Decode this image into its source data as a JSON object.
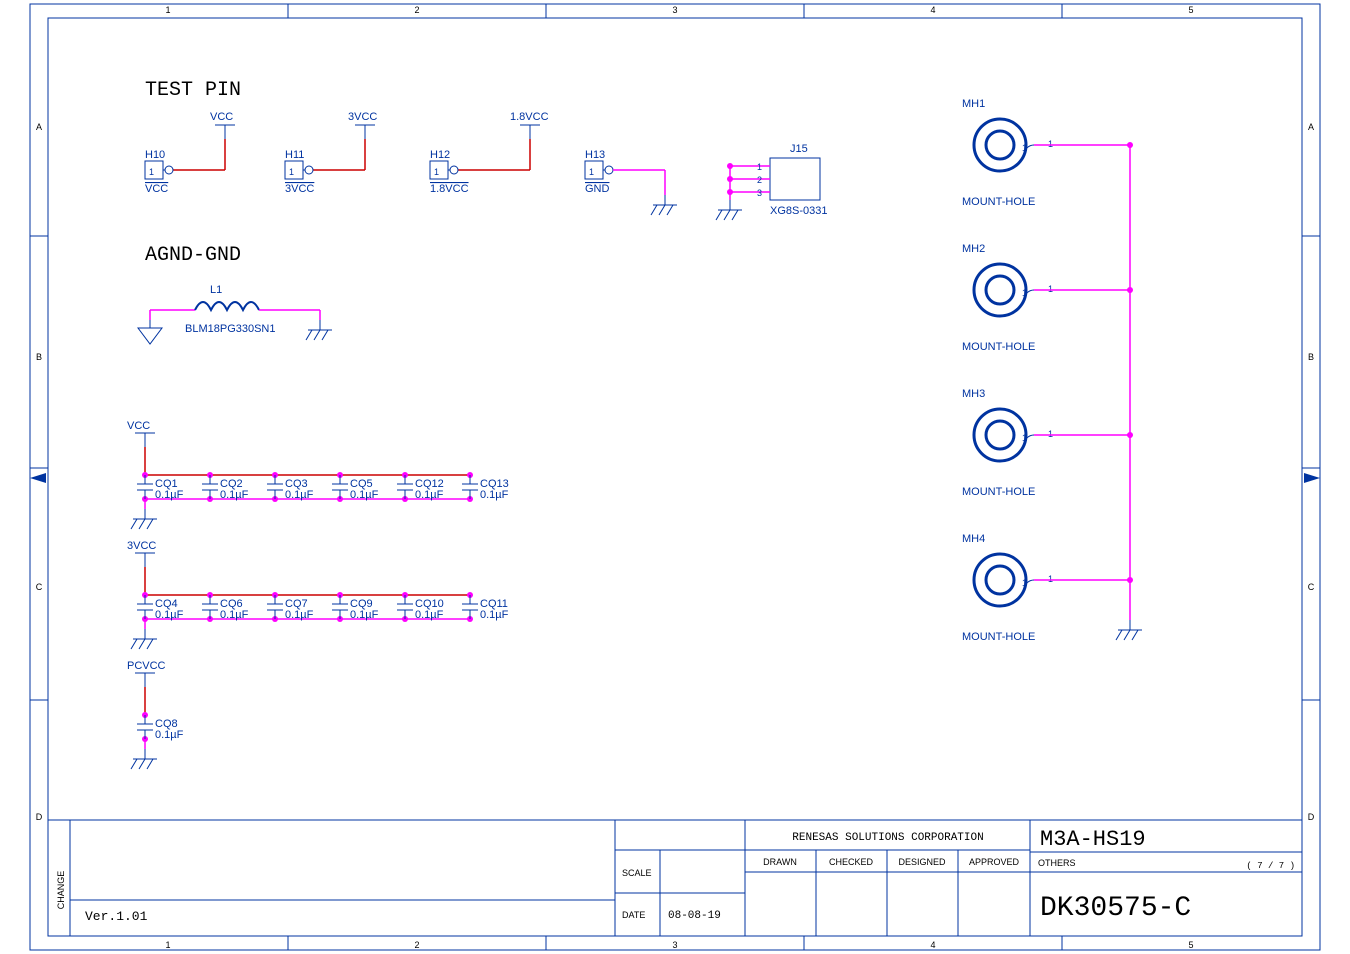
{
  "sections": {
    "testpin": "TEST PIN",
    "agnd": "AGND-GND"
  },
  "headers": {
    "H10": {
      "ref": "H10",
      "pin": "1",
      "label": "VCC",
      "net": "VCC"
    },
    "H11": {
      "ref": "H11",
      "pin": "1",
      "label": "3VCC",
      "net": "3VCC"
    },
    "H12": {
      "ref": "H12",
      "pin": "1",
      "label": "1.8VCC",
      "net": "1.8VCC"
    },
    "H13": {
      "ref": "H13",
      "pin": "1",
      "label": "GND"
    }
  },
  "connector": {
    "ref": "J15",
    "pins": [
      "1",
      "2",
      "3"
    ],
    "part": "XG8S-0331"
  },
  "inductor": {
    "ref": "L1",
    "part": "BLM18PG330SN1"
  },
  "caps": {
    "vcc": {
      "net": "VCC",
      "items": [
        "CQ1",
        "CQ2",
        "CQ3",
        "CQ5",
        "CQ12",
        "CQ13"
      ],
      "val": "0.1µF"
    },
    "v3": {
      "net": "3VCC",
      "items": [
        "CQ4",
        "CQ6",
        "CQ7",
        "CQ9",
        "CQ10",
        "CQ11"
      ],
      "val": "0.1µF"
    },
    "pcv": {
      "net": "PCVCC",
      "items": [
        "CQ8"
      ],
      "val": "0.1µF"
    }
  },
  "mounts": [
    {
      "ref": "MH1",
      "label": "MOUNT-HOLE",
      "pin": "1"
    },
    {
      "ref": "MH2",
      "label": "MOUNT-HOLE",
      "pin": "1"
    },
    {
      "ref": "MH3",
      "label": "MOUNT-HOLE",
      "pin": "1"
    },
    {
      "ref": "MH4",
      "label": "MOUNT-HOLE",
      "pin": "1"
    }
  ],
  "titleblock": {
    "company": "RENESAS SOLUTIONS CORPORATION",
    "change": "CHANGE",
    "scale_l": "SCALE",
    "scale": "",
    "date_l": "DATE",
    "date": "08-08-19",
    "drawn": "DRAWN",
    "checked": "CHECKED",
    "designed": "DESIGNED",
    "approved": "APPROVED",
    "title": "M3A-HS19",
    "others": "OTHERS",
    "sheet": "( 7  / 7  )",
    "dwg": "DK30575-C",
    "ver": "Ver.1.01"
  },
  "cols": [
    "1",
    "2",
    "3",
    "4",
    "5"
  ],
  "rows": [
    "A",
    "B",
    "C",
    "D"
  ]
}
